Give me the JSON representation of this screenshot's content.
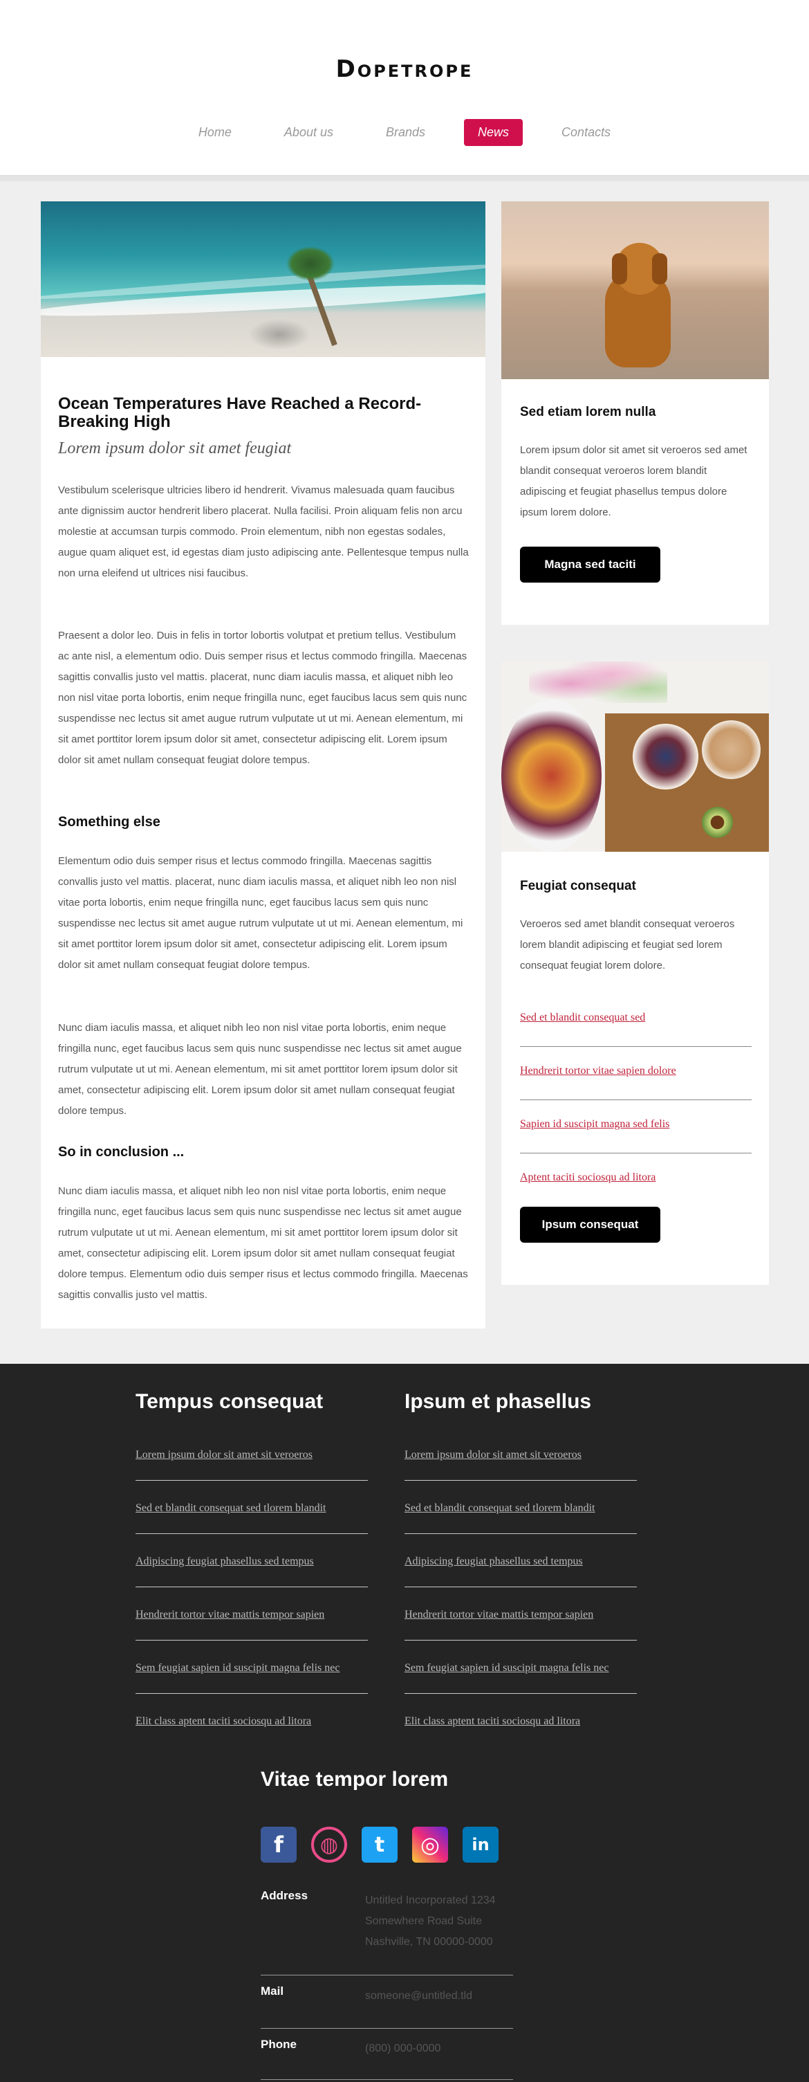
{
  "header": {
    "logo": "Dopetrope",
    "nav": [
      "Home",
      "About us",
      "Brands",
      "News",
      "Contacts"
    ],
    "active_nav": "News",
    "accent_color": "#d0104c"
  },
  "article": {
    "title": "Ocean Temperatures Have Reached a Record-Breaking High",
    "subtitle": "Lorem ipsum dolor sit amet feugiat",
    "paragraphs": [
      "Vestibulum scelerisque ultricies libero id hendrerit. Vivamus malesuada quam faucibus ante dignissim auctor hendrerit libero placerat. Nulla facilisi. Proin aliquam felis non arcu molestie at accumsan turpis commodo. Proin elementum, nibh non egestas sodales, augue quam aliquet est, id egestas diam justo adipiscing ante. Pellentesque tempus nulla non urna eleifend ut ultrices nisi faucibus.",
      "Praesent a dolor leo. Duis in felis in tortor lobortis volutpat et pretium tellus. Vestibulum ac ante nisl, a elementum odio. Duis semper risus et lectus commodo fringilla. Maecenas sagittis convallis justo vel mattis. placerat, nunc diam iaculis massa, et aliquet nibh leo non nisl vitae porta lobortis, enim neque fringilla nunc, eget faucibus lacus sem quis nunc suspendisse nec lectus sit amet augue rutrum vulputate ut ut mi. Aenean elementum, mi sit amet porttitor lorem ipsum dolor sit amet, consectetur adipiscing elit. Lorem ipsum dolor sit amet nullam consequat feugiat dolore tempus."
    ],
    "heading2": "Something else",
    "paragraphs2": [
      "Elementum odio duis semper risus et lectus commodo fringilla. Maecenas sagittis convallis justo vel mattis. placerat, nunc diam iaculis massa, et aliquet nibh leo non nisl vitae porta lobortis, enim neque fringilla nunc, eget faucibus lacus sem quis nunc suspendisse nec lectus sit amet augue rutrum vulputate ut ut mi. Aenean elementum, mi sit amet porttitor lorem ipsum dolor sit amet, consectetur adipiscing elit. Lorem ipsum dolor sit amet nullam consequat feugiat dolore tempus.",
      "Nunc diam iaculis massa, et aliquet nibh leo non nisl vitae porta lobortis, enim neque fringilla nunc, eget faucibus lacus sem quis nunc suspendisse nec lectus sit amet augue rutrum vulputate ut ut mi. Aenean elementum, mi sit amet porttitor lorem ipsum dolor sit amet, consectetur adipiscing elit. Lorem ipsum dolor sit amet nullam consequat feugiat dolore tempus."
    ],
    "heading3": "So in conclusion ...",
    "paragraph3": "Nunc diam iaculis massa, et aliquet nibh leo non nisl vitae porta lobortis, enim neque fringilla nunc, eget faucibus lacus sem quis nunc suspendisse nec lectus sit amet augue rutrum vulputate ut ut mi. Aenean elementum, mi sit amet porttitor lorem ipsum dolor sit amet, consectetur adipiscing elit. Lorem ipsum dolor sit amet nullam consequat feugiat dolore tempus. Elementum odio duis semper risus et lectus commodo fringilla. Maecenas sagittis convallis justo vel mattis."
  },
  "sidebar": {
    "box1": {
      "title": "Sed etiam lorem nulla",
      "text": "Lorem ipsum dolor sit amet sit veroeros sed amet blandit consequat veroeros lorem blandit adipiscing et feugiat phasellus tempus dolore ipsum lorem dolore.",
      "button": "Magna sed taciti"
    },
    "box2": {
      "title": "Feugiat consequat",
      "text": "Veroeros sed amet blandit consequat veroeros lorem blandit adipiscing et feugiat sed lorem consequat feugiat lorem dolore.",
      "links": [
        "Sed et blandit consequat sed",
        "Hendrerit tortor vitae sapien dolore",
        "Sapien id suscipit magna sed felis",
        "Aptent taciti sociosqu ad litora"
      ],
      "button": "Ipsum consequat"
    }
  },
  "footer": {
    "col1": {
      "title": "Tempus consequat",
      "links": [
        "Lorem ipsum dolor sit amet sit veroeros",
        "Sed et blandit consequat sed tlorem blandit",
        "Adipiscing feugiat phasellus sed tempus",
        "Hendrerit tortor vitae mattis tempor sapien",
        "Sem feugiat sapien id suscipit magna felis nec",
        "Elit class aptent taciti sociosqu ad litora"
      ]
    },
    "col2": {
      "title": "Ipsum et phasellus",
      "links": [
        "Lorem ipsum dolor sit amet sit veroeros",
        "Sed et blandit consequat sed tlorem blandit",
        "Adipiscing feugiat phasellus sed tempus",
        "Hendrerit tortor vitae mattis tempor sapien",
        "Sem feugiat sapien id suscipit magna felis nec",
        "Elit class aptent taciti sociosqu ad litora"
      ]
    },
    "contact": {
      "title": "Vitae tempor lorem",
      "social": [
        {
          "icon": "facebook-icon",
          "glyph": "f",
          "color": "#3b5998"
        },
        {
          "icon": "dribbble-icon",
          "glyph": "◍",
          "color": "#ea4c89"
        },
        {
          "icon": "twitter-icon",
          "glyph": "t",
          "color": "#1da1f2"
        },
        {
          "icon": "instagram-icon",
          "glyph": "◎",
          "color": "#c13584"
        },
        {
          "icon": "linkedin-icon",
          "glyph": "in",
          "color": "#0077b5"
        }
      ],
      "address_label": "Address",
      "address_lines": [
        "Untitled Incorporated 1234",
        "Somewhere Road Suite",
        "Nashville, TN 00000-0000"
      ],
      "mail_label": "Mail",
      "mail": "someone@untitled.tld",
      "phone_label": "Phone",
      "phone": "(800) 000-0000"
    }
  }
}
